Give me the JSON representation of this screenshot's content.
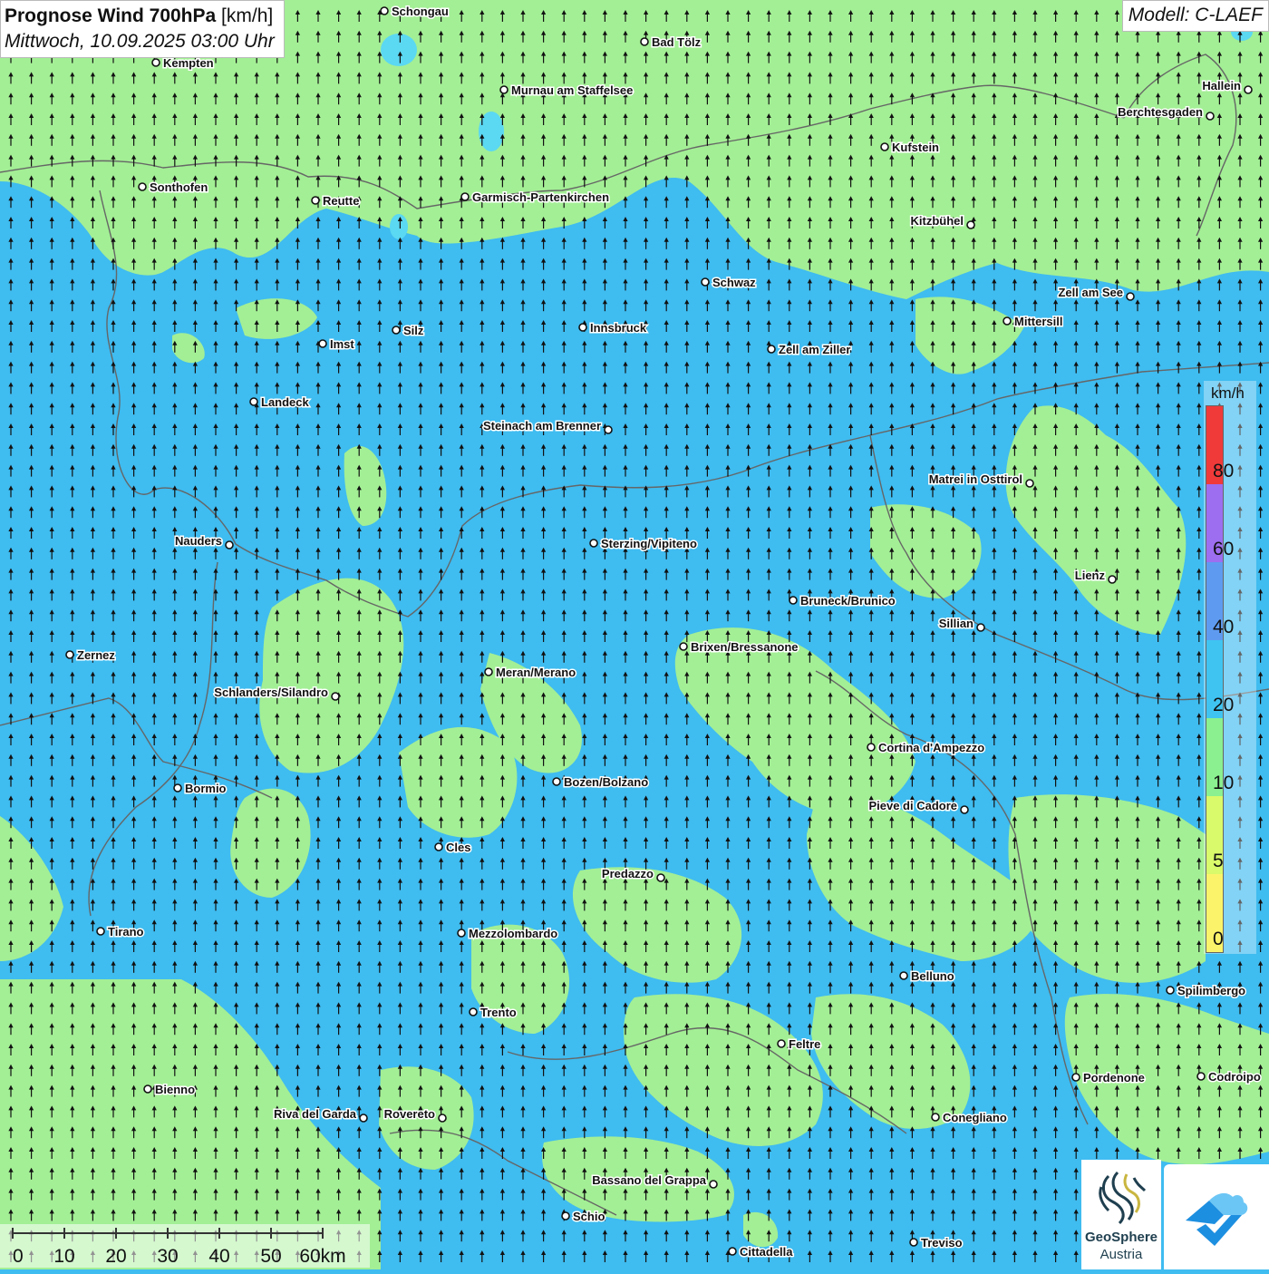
{
  "header": {
    "title_bold": "Prognose Wind 700hPa",
    "title_unit": " [km/h]",
    "subtitle": "Mittwoch, 10.09.2025 03:00 Uhr",
    "model": "Modell: C-LAEF"
  },
  "legend": {
    "unit": "km/h",
    "labels": [
      "80",
      "60",
      "40",
      "20",
      "10",
      "5",
      "0"
    ],
    "colors": [
      "#f03a3a",
      "#9d6ef0",
      "#5e9bf0",
      "#3fc4f2",
      "#8af090",
      "#d9fa6a",
      "#fbf46a"
    ]
  },
  "map": {
    "colors": {
      "calm": "#3fbcf0",
      "breeze": "#a3ef95",
      "border": "#666666",
      "lake": "#5bd8f2"
    },
    "wind_arrow_icon": "north-arrow-icon",
    "places": [
      {
        "name": "Schongau",
        "side": "r"
      },
      {
        "name": "Bad Tölz",
        "side": "r"
      },
      {
        "name": "Kempten",
        "side": "r"
      },
      {
        "name": "Murnau am Staffelsee",
        "side": "r"
      },
      {
        "name": "Hallein",
        "side": "l"
      },
      {
        "name": "Berchtesgaden",
        "side": "l"
      },
      {
        "name": "Kufstein",
        "side": "r"
      },
      {
        "name": "Sonthofen",
        "side": "r"
      },
      {
        "name": "Reutte",
        "side": "r"
      },
      {
        "name": "Garmisch-Partenkirchen",
        "side": "r"
      },
      {
        "name": "Kitzbühel",
        "side": "l"
      },
      {
        "name": "Schwaz",
        "side": "r"
      },
      {
        "name": "Zell am See",
        "side": "l"
      },
      {
        "name": "Mittersill",
        "side": "r"
      },
      {
        "name": "Innsbruck",
        "side": "r"
      },
      {
        "name": "Silz",
        "side": "r"
      },
      {
        "name": "Imst",
        "side": "r"
      },
      {
        "name": "Zell am Ziller",
        "side": "r"
      },
      {
        "name": "Landeck",
        "side": "r"
      },
      {
        "name": "Steinach am Brenner",
        "side": "l"
      },
      {
        "name": "Matrei in Osttirol",
        "side": "l"
      },
      {
        "name": "Nauders",
        "side": "l"
      },
      {
        "name": "Sterzing/Vipiteno",
        "side": "r"
      },
      {
        "name": "Lienz",
        "side": "l"
      },
      {
        "name": "Bruneck/Brunico",
        "side": "r"
      },
      {
        "name": "Sillian",
        "side": "l"
      },
      {
        "name": "Zernez",
        "side": "r"
      },
      {
        "name": "Brixen/Bressanone",
        "side": "r"
      },
      {
        "name": "Meran/Merano",
        "side": "r"
      },
      {
        "name": "Schlanders/Silandro",
        "side": "l"
      },
      {
        "name": "Cortina d'Ampezzo",
        "side": "r"
      },
      {
        "name": "Bozen/Bolzano",
        "side": "r"
      },
      {
        "name": "Bormio",
        "side": "r"
      },
      {
        "name": "Pieve di Cadore",
        "side": "l"
      },
      {
        "name": "Cles",
        "side": "r"
      },
      {
        "name": "Predazzo",
        "side": "l"
      },
      {
        "name": "Tirano",
        "side": "r"
      },
      {
        "name": "Mezzolombardo",
        "side": "r"
      },
      {
        "name": "Belluno",
        "side": "r"
      },
      {
        "name": "Spilimbergo",
        "side": "r"
      },
      {
        "name": "Trento",
        "side": "r"
      },
      {
        "name": "Feltre",
        "side": "r"
      },
      {
        "name": "Pordenone",
        "side": "r"
      },
      {
        "name": "Codroipo",
        "side": "r"
      },
      {
        "name": "Bienno",
        "side": "r"
      },
      {
        "name": "Riva del Garda",
        "side": "l"
      },
      {
        "name": "Rovereto",
        "side": "l"
      },
      {
        "name": "Conegliano",
        "side": "r"
      },
      {
        "name": "Bassano del Grappa",
        "side": "l"
      },
      {
        "name": "Schio",
        "side": "r"
      },
      {
        "name": "Treviso",
        "side": "r"
      },
      {
        "name": "Cittadella",
        "side": "r"
      }
    ]
  },
  "scalebar": {
    "ticks": [
      "0",
      "10",
      "20",
      "30",
      "40",
      "50",
      "60km"
    ]
  },
  "logo": {
    "name": "GeoSphere",
    "sub": "Austria"
  }
}
